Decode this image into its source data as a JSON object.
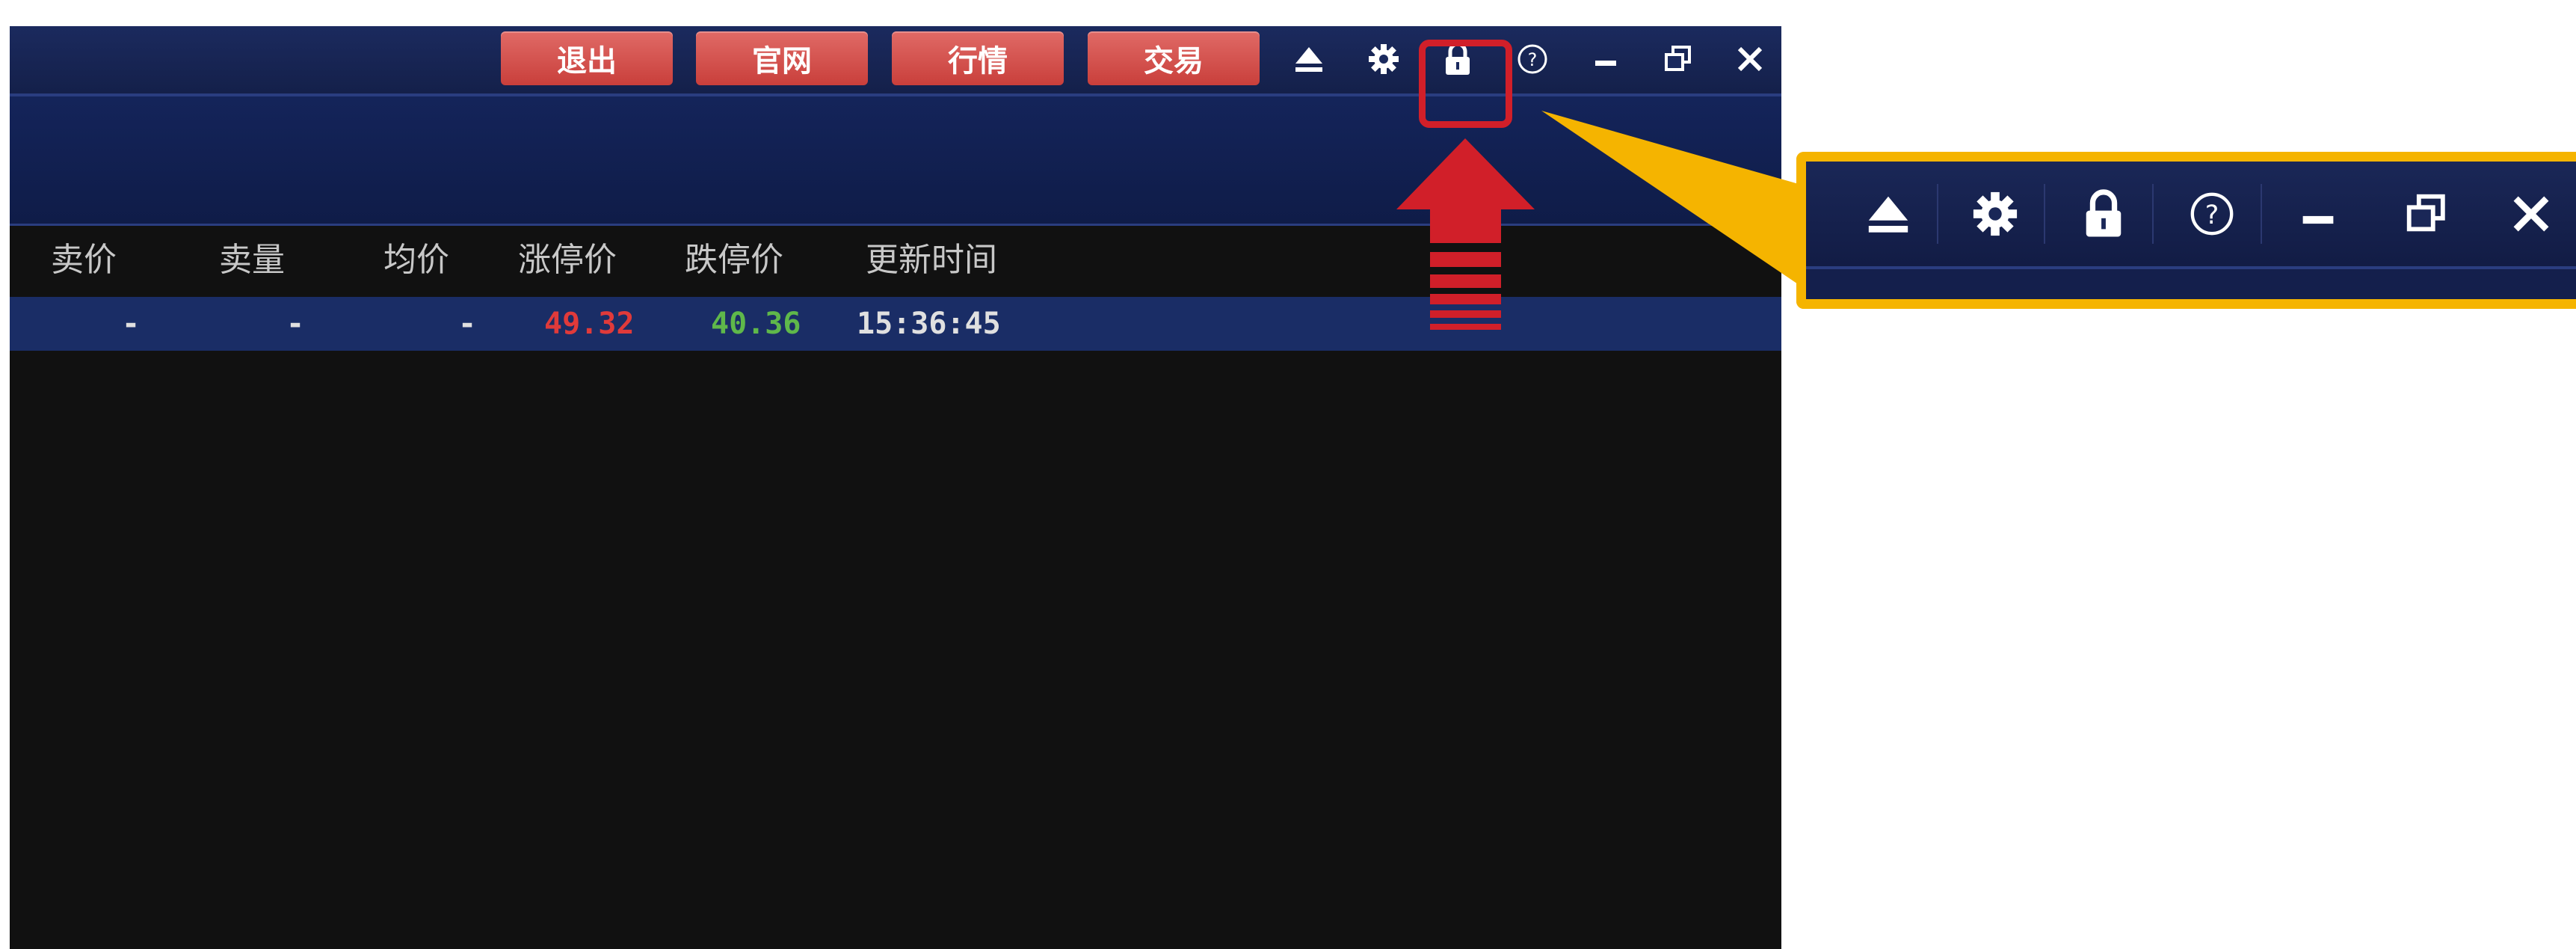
{
  "toolbar": {
    "buttons": [
      "退出",
      "官网",
      "行情",
      "交易"
    ]
  },
  "icons": [
    "eject-icon",
    "gear-icon",
    "lock-icon",
    "help-icon",
    "minimize-icon",
    "restore-icon",
    "close-icon"
  ],
  "table": {
    "headers": [
      "卖价",
      "卖量",
      "均价",
      "涨停价",
      "跌停价",
      "更新时间"
    ],
    "row": {
      "sell_price": "-",
      "sell_volume": "-",
      "avg_price": "-",
      "limit_up": "49.32",
      "limit_down": "40.36",
      "update_time": "15:36:45"
    }
  },
  "colors": {
    "limit_up": "#e03a3a",
    "limit_down": "#5fb84a",
    "highlight": "#d11f29",
    "callout": "#f5b400",
    "titlebar": "#1b2a5e"
  }
}
